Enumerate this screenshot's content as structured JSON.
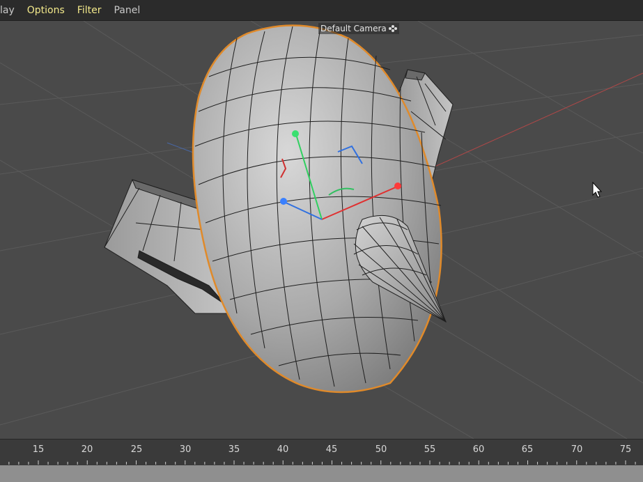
{
  "menu": {
    "items": [
      {
        "label": "lay",
        "style": "plain"
      },
      {
        "label": "Options",
        "style": "accent"
      },
      {
        "label": "Filter",
        "style": "accent"
      },
      {
        "label": "Panel",
        "style": "plain"
      }
    ]
  },
  "viewport": {
    "camera_label": "Default Camera",
    "camera_icon": "camera-dots-icon",
    "selection_outline_color": "#e08a2a",
    "axis_colors": {
      "x": "#e03030",
      "y": "#30d060",
      "z": "#3070e0"
    }
  },
  "timeline": {
    "ticks": [
      "15",
      "20",
      "25",
      "30",
      "35",
      "40",
      "45",
      "50",
      "55",
      "60",
      "65",
      "70",
      "75"
    ]
  }
}
